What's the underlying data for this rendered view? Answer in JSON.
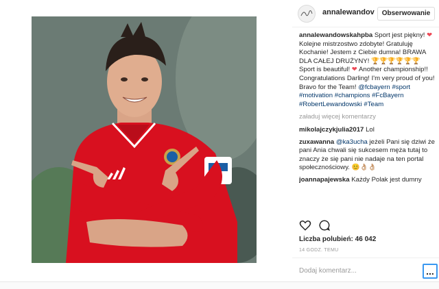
{
  "header": {
    "username": "annalewandov",
    "follow_label": "Obserwowanie",
    "avatar_icon": "avatar-signature-icon"
  },
  "caption": {
    "username": "annalewandowskahpba",
    "text_pl_1": " Sport jest piękny! ",
    "text_pl_2": " Kolejne mistrzostwo zdobyte! Gratuluję Kochanie! Jestem z Ciebie dumna! BRAWA DLA CAŁEJ DRUŻYNY! ",
    "trophies": "🏆🏆🏆🏆🏆🏆",
    "text_en_1": "Sport is beautiful! ",
    "text_en_2": " Another championship!! Congratulations Darling! I'm very proud of you! Bravo for the Team! ",
    "tag_mention": "@fcbayern",
    "tag_1": "#sport",
    "tag_2": "#motivation",
    "tag_3": "#champions",
    "tag_4": "#FcBayern",
    "tag_5": "#RobertLewandowski",
    "tag_6": "#Team"
  },
  "load_more_label": "załaduj więcej komentarzy",
  "comments": [
    {
      "user": "mikolajczykjulia2017",
      "text": " Lol"
    },
    {
      "user": "zuxawanna",
      "mention": "@ka3ucha",
      "text": " jeżeli Pani się dziwi że pani Ania chwali się sukcesem męża tutaj to znaczy że się pani nie nadaje na ten portal społecznościowy. 😊👌🏼👌🏼"
    },
    {
      "user": "joannapajewska",
      "text": " Każdy Polak jest dumny"
    }
  ],
  "actions": {
    "like_icon": "heart-outline-icon",
    "comment_icon": "speech-bubble-icon"
  },
  "likes_text": "Liczba polubień: 46 042",
  "time_text": "14 GODZ. TEMU",
  "add_comment_placeholder": "Dodaj komentarz...",
  "more_label": "...",
  "colors": {
    "link": "#003569",
    "follow_border": "#dbdbdb",
    "focus": "#3897f0",
    "jersey": "#d8101f"
  }
}
